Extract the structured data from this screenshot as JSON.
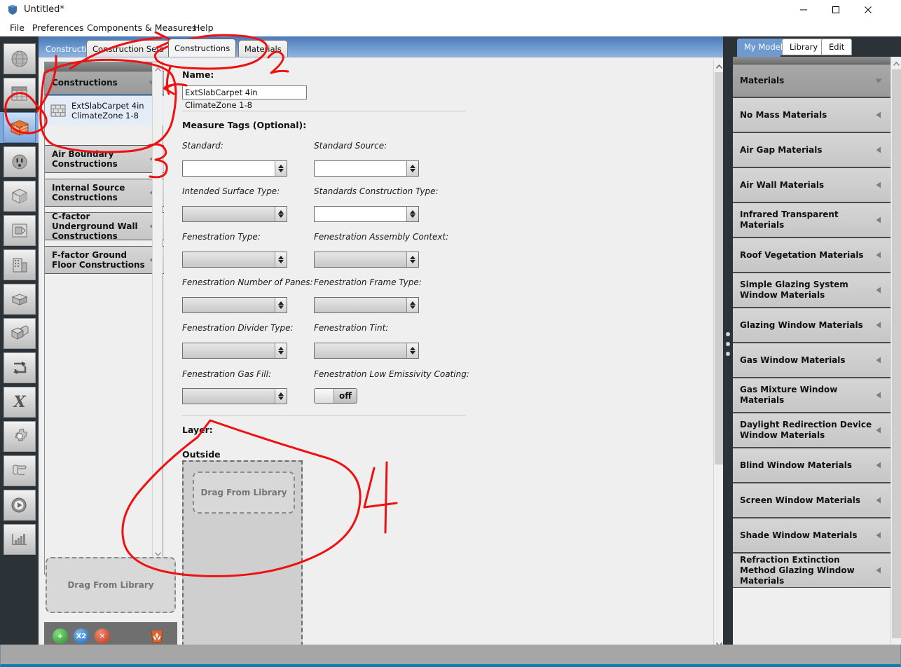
{
  "window": {
    "title": "Untitled*",
    "app_icon": "cube-icon",
    "minimize_label": "—",
    "maximize_label": "□",
    "close_label": "✕"
  },
  "menubar": {
    "items": [
      {
        "label": "File"
      },
      {
        "label": "Preferences"
      },
      {
        "label": "Components & Measures"
      },
      {
        "label": "Help"
      }
    ]
  },
  "left_toolbar": {
    "items": [
      {
        "icon": "site-globe-icon",
        "selected": false
      },
      {
        "icon": "schedules-calendar-icon",
        "selected": false
      },
      {
        "icon": "constructions-brick-icon",
        "selected": true
      },
      {
        "icon": "loads-outlet-icon",
        "selected": false
      },
      {
        "icon": "space-types-cube-icon",
        "selected": false
      },
      {
        "icon": "geometry-plan-icon",
        "selected": false
      },
      {
        "icon": "facility-building-icon",
        "selected": false
      },
      {
        "icon": "spaces-box-icon",
        "selected": false
      },
      {
        "icon": "thermal-zones-blocks-icon",
        "selected": false
      },
      {
        "icon": "hvac-loop-icon",
        "selected": false
      },
      {
        "icon": "variables-x-icon",
        "selected": false
      },
      {
        "icon": "simulation-settings-gear-icon",
        "selected": false
      },
      {
        "icon": "measures-scroll-icon",
        "selected": false
      },
      {
        "icon": "run-play-icon",
        "selected": false
      },
      {
        "icon": "results-chart-icon",
        "selected": false
      }
    ]
  },
  "tabs": [
    {
      "label": "Constructions",
      "state": "flat"
    },
    {
      "label": "Construction Sets",
      "state": "inactive"
    },
    {
      "label": "Constructions",
      "state": "active"
    },
    {
      "label": "Materials",
      "state": "inactive"
    }
  ],
  "left_panel": {
    "groups": [
      {
        "label": "Constructions",
        "expanded": true,
        "caret": "caret-down-icon",
        "items": [
          {
            "icon": "brick-construction-icon",
            "label": "ExtSlabCarpet 4in ClimateZone 1-8",
            "selected": true
          }
        ]
      },
      {
        "label": "Air Boundary Constructions",
        "expanded": false,
        "caret": "caret-left-icon",
        "items": []
      },
      {
        "label": "Internal Source Constructions",
        "expanded": false,
        "caret": "caret-left-icon",
        "items": []
      },
      {
        "label": "C-factor Underground Wall Constructions",
        "expanded": false,
        "caret": "caret-left-icon",
        "items": []
      },
      {
        "label": "F-factor Ground Floor Constructions",
        "expanded": false,
        "caret": "caret-left-icon",
        "items": []
      }
    ],
    "drag_label": "Drag From Library",
    "toolbar": {
      "add": {
        "icon": "plus-icon",
        "label": "+",
        "color": "#3fa340"
      },
      "duplicate": {
        "icon": "duplicate-icon",
        "label": "X2",
        "color": "#2a7fd4"
      },
      "remove": {
        "icon": "remove-x-icon",
        "label": "✕",
        "color": "#d4452a"
      },
      "purge": {
        "icon": "recycle-bin-icon",
        "color": "#e2622c"
      }
    }
  },
  "form": {
    "name_label": "Name:",
    "name_value": "ExtSlabCarpet 4in ClimateZone 1-8",
    "measure_tags_label": "Measure Tags (Optional):",
    "fields": [
      {
        "label": "Standard:",
        "value": "",
        "style": "white",
        "col": 0,
        "row": 0
      },
      {
        "label": "Standard Source:",
        "value": "",
        "style": "white",
        "col": 1,
        "row": 0
      },
      {
        "label": "Intended Surface Type:",
        "value": "",
        "style": "gray",
        "col": 0,
        "row": 1
      },
      {
        "label": "Standards Construction Type:",
        "value": "",
        "style": "white",
        "col": 1,
        "row": 1
      },
      {
        "label": "Fenestration Type:",
        "value": "",
        "style": "gray",
        "col": 0,
        "row": 2
      },
      {
        "label": "Fenestration Assembly Context:",
        "value": "",
        "style": "gray",
        "col": 1,
        "row": 2
      },
      {
        "label": "Fenestration Number of Panes:",
        "value": "",
        "style": "gray",
        "col": 0,
        "row": 3
      },
      {
        "label": "Fenestration Frame Type:",
        "value": "",
        "style": "gray",
        "col": 1,
        "row": 3
      },
      {
        "label": "Fenestration Divider Type:",
        "value": "",
        "style": "gray",
        "col": 0,
        "row": 4
      },
      {
        "label": "Fenestration Tint:",
        "value": "",
        "style": "gray",
        "col": 1,
        "row": 4
      },
      {
        "label": "Fenestration Gas Fill:",
        "value": "",
        "style": "gray",
        "col": 0,
        "row": 5
      }
    ],
    "low_e_label": "Fenestration Low Emissivity Coating:",
    "low_e_state": "off",
    "layer_label": "Layer:",
    "outside_label": "Outside",
    "layer_drag_label": "Drag From Library"
  },
  "right_panel": {
    "tabs": [
      {
        "label": "My Model",
        "active": true
      },
      {
        "label": "Library",
        "active": false
      },
      {
        "label": "Edit",
        "active": false
      }
    ],
    "groups": [
      {
        "label": "Materials",
        "expanded": true,
        "caret": "caret-down-icon"
      },
      {
        "label": "No Mass Materials",
        "expanded": false,
        "caret": "caret-left-icon"
      },
      {
        "label": "Air Gap Materials",
        "expanded": false,
        "caret": "caret-left-icon"
      },
      {
        "label": "Air Wall Materials",
        "expanded": false,
        "caret": "caret-left-icon"
      },
      {
        "label": "Infrared Transparent Materials",
        "expanded": false,
        "caret": "caret-left-icon"
      },
      {
        "label": "Roof Vegetation Materials",
        "expanded": false,
        "caret": "caret-left-icon"
      },
      {
        "label": "Simple Glazing System Window Materials",
        "expanded": false,
        "caret": "caret-left-icon"
      },
      {
        "label": "Glazing Window Materials",
        "expanded": false,
        "caret": "caret-left-icon"
      },
      {
        "label": "Gas Window Materials",
        "expanded": false,
        "caret": "caret-left-icon"
      },
      {
        "label": "Gas Mixture Window Materials",
        "expanded": false,
        "caret": "caret-left-icon"
      },
      {
        "label": "Daylight Redirection Device Window Materials",
        "expanded": false,
        "caret": "caret-left-icon"
      },
      {
        "label": "Blind Window Materials",
        "expanded": false,
        "caret": "caret-left-icon"
      },
      {
        "label": "Screen Window Materials",
        "expanded": false,
        "caret": "caret-left-icon"
      },
      {
        "label": "Shade Window Materials",
        "expanded": false,
        "caret": "caret-left-icon"
      },
      {
        "label": "Refraction Extinction Method Glazing Window Materials",
        "expanded": false,
        "caret": "caret-left-icon"
      }
    ]
  },
  "annotations": {
    "marks": [
      "1",
      "2",
      "3",
      "4"
    ],
    "color": "#ee1111"
  },
  "colors": {
    "accent_blue": "#6e9ad0",
    "dark_rail": "#2b3338",
    "panel_gray": "#efefef",
    "status_accent": "#0b7fab",
    "annotation_red": "#ee1111"
  }
}
